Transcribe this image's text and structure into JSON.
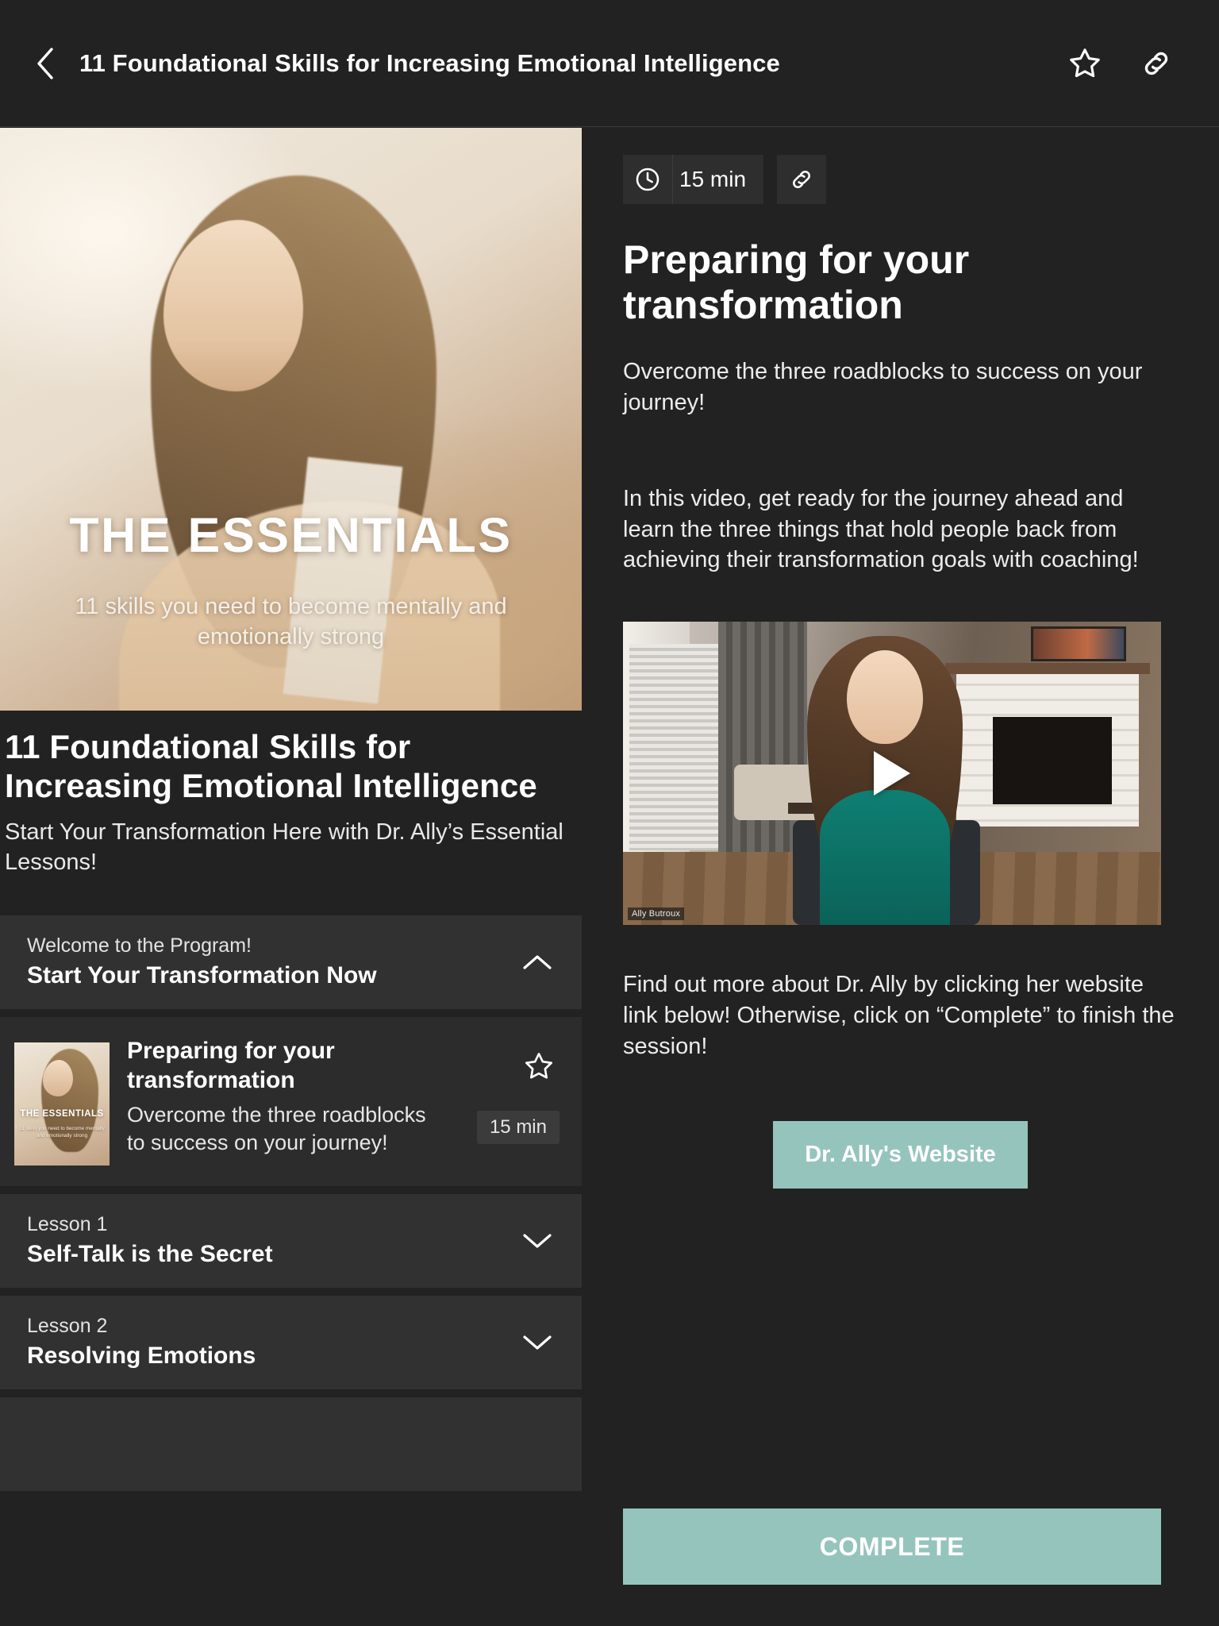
{
  "header": {
    "back_icon": "chevron-left-icon",
    "title": "11 Foundational Skills for Increasing Emotional Intelligence",
    "favorite_icon": "star-outline-icon",
    "share_icon": "link-icon"
  },
  "hero": {
    "title": "THE ESSENTIALS",
    "subtitle": "11 skills you need to become mentally and emotionally strong"
  },
  "course": {
    "title": "11 Foundational Skills for Increasing Emotional Intelligence",
    "subtitle": "Start Your Transformation Here with Dr. Ally’s Essential Lessons!"
  },
  "modules": [
    {
      "kicker": "Welcome to the Program!",
      "name": "Start Your Transformation Now",
      "expanded": true,
      "chevron": "chevron-up-icon"
    },
    {
      "kicker": "Lesson 1",
      "name": "Self-Talk is the Secret",
      "expanded": false,
      "chevron": "chevron-down-icon"
    },
    {
      "kicker": "Lesson 2",
      "name": "Resolving Emotions",
      "expanded": false,
      "chevron": "chevron-down-icon"
    }
  ],
  "lesson": {
    "title": "Preparing for your transformation",
    "description": "Overcome the three roadblocks to success on your journey!",
    "duration": "15 min",
    "star_icon": "star-outline-icon",
    "thumb_title": "THE ESSENTIALS",
    "thumb_sub": "11 skills you need to become mentally and emotionally strong"
  },
  "detail": {
    "duration": "15 min",
    "clock_icon": "clock-icon",
    "share_icon": "link-icon",
    "title": "Preparing for your transformation",
    "lead": "Overcome the three roadblocks to success on your journey!",
    "paragraph": "In this video, get ready for the journey ahead and learn the three things that hold people back from achieving their transformation goals with coaching!",
    "closing": "Find out more about Dr. Ally by clicking her website link below! Otherwise, click on “Complete” to finish the session!",
    "video_watermark": "Ally Butroux",
    "play_icon": "play-icon",
    "website_button": "Dr. Ally's Website",
    "complete_button": "COMPLETE"
  },
  "colors": {
    "background": "#222222",
    "surface": "#2c2c2c",
    "surface_alt": "#313131",
    "accent_teal": "#95c4bd",
    "text_primary": "#ffffff",
    "text_secondary": "#e6e6e6"
  }
}
